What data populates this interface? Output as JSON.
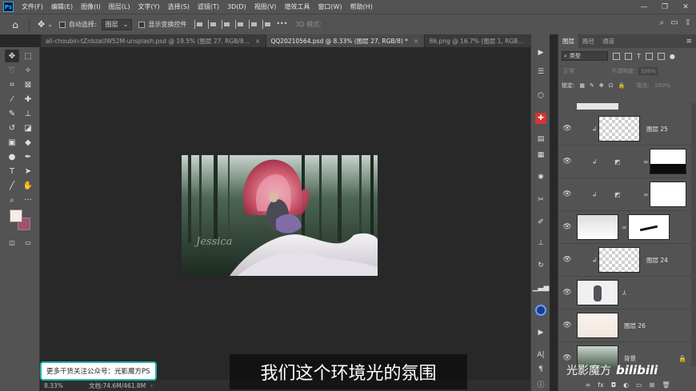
{
  "app": {
    "logo": "Ps",
    "menu": [
      "文件(F)",
      "编辑(E)",
      "图像(I)",
      "图层(L)",
      "文字(Y)",
      "选择(S)",
      "滤镜(T)",
      "3D(D)",
      "视图(V)",
      "增效工具",
      "窗口(W)",
      "帮助(H)"
    ],
    "window_controls": [
      "—",
      "❐",
      "✕"
    ]
  },
  "options_bar": {
    "auto_select_label": "自动选择:",
    "auto_select_value": "图层",
    "transform_controls_label": "显示变换控件",
    "mode_3d_label": "3D 模式:"
  },
  "tabs": [
    {
      "label": "ali-choubin-tZnbzaUW52M-unsplash.psd @ 19.5% (图层 27, RGB/8...",
      "close": "×",
      "active": false
    },
    {
      "label": "QQ20210564.psd @ 8.33% (图层 27, RGB/8) *",
      "close": "×",
      "active": true
    },
    {
      "label": "86.png @ 16.7% (图层 1, RGB...",
      "close": "×",
      "active": false
    }
  ],
  "canvas": {
    "signature": "Jessica"
  },
  "colors": {
    "foreground": "#f7ece6",
    "background": "#a25070",
    "accent_promo": "#1fb5ad"
  },
  "status": {
    "zoom": "8.33%",
    "doc_size": "文档:74.6M/461.8M",
    "arrow": "›"
  },
  "overlay": {
    "promo": "更多干货关注公众号：光影魔方PS",
    "subtitle": "我们这个环境光的氛围",
    "watermark_text": "光影魔方",
    "watermark_logo": "bilibili"
  },
  "layers_panel": {
    "tabs": [
      "图层",
      "路径",
      "通道"
    ],
    "filter_label": "类型",
    "blend_mode": "正常",
    "opacity_label": "不透明度:",
    "opacity_value": "100%",
    "lock_label": "锁定:",
    "fill_label": "填充:",
    "fill_value": "100%",
    "layers": [
      {
        "name": "图层 25",
        "clipped": true,
        "thumb": "checker",
        "mask": "none"
      },
      {
        "name": "",
        "clipped": true,
        "thumb": "adjust",
        "mask": "dark-bottom"
      },
      {
        "name": "",
        "clipped": true,
        "thumb": "adjust",
        "mask": "white"
      },
      {
        "name": "",
        "clipped": false,
        "thumb": "white-fabric",
        "mask": "black-stroke"
      },
      {
        "name": "图层 24",
        "clipped": true,
        "thumb": "checker",
        "mask": "none"
      },
      {
        "name": "",
        "clipped": false,
        "thumb": "figure",
        "mask": "none"
      },
      {
        "name": "图层 26",
        "clipped": false,
        "thumb": "haze",
        "mask": "none"
      },
      {
        "name": "背景",
        "clipped": false,
        "thumb": "forest",
        "mask": "none"
      }
    ]
  }
}
